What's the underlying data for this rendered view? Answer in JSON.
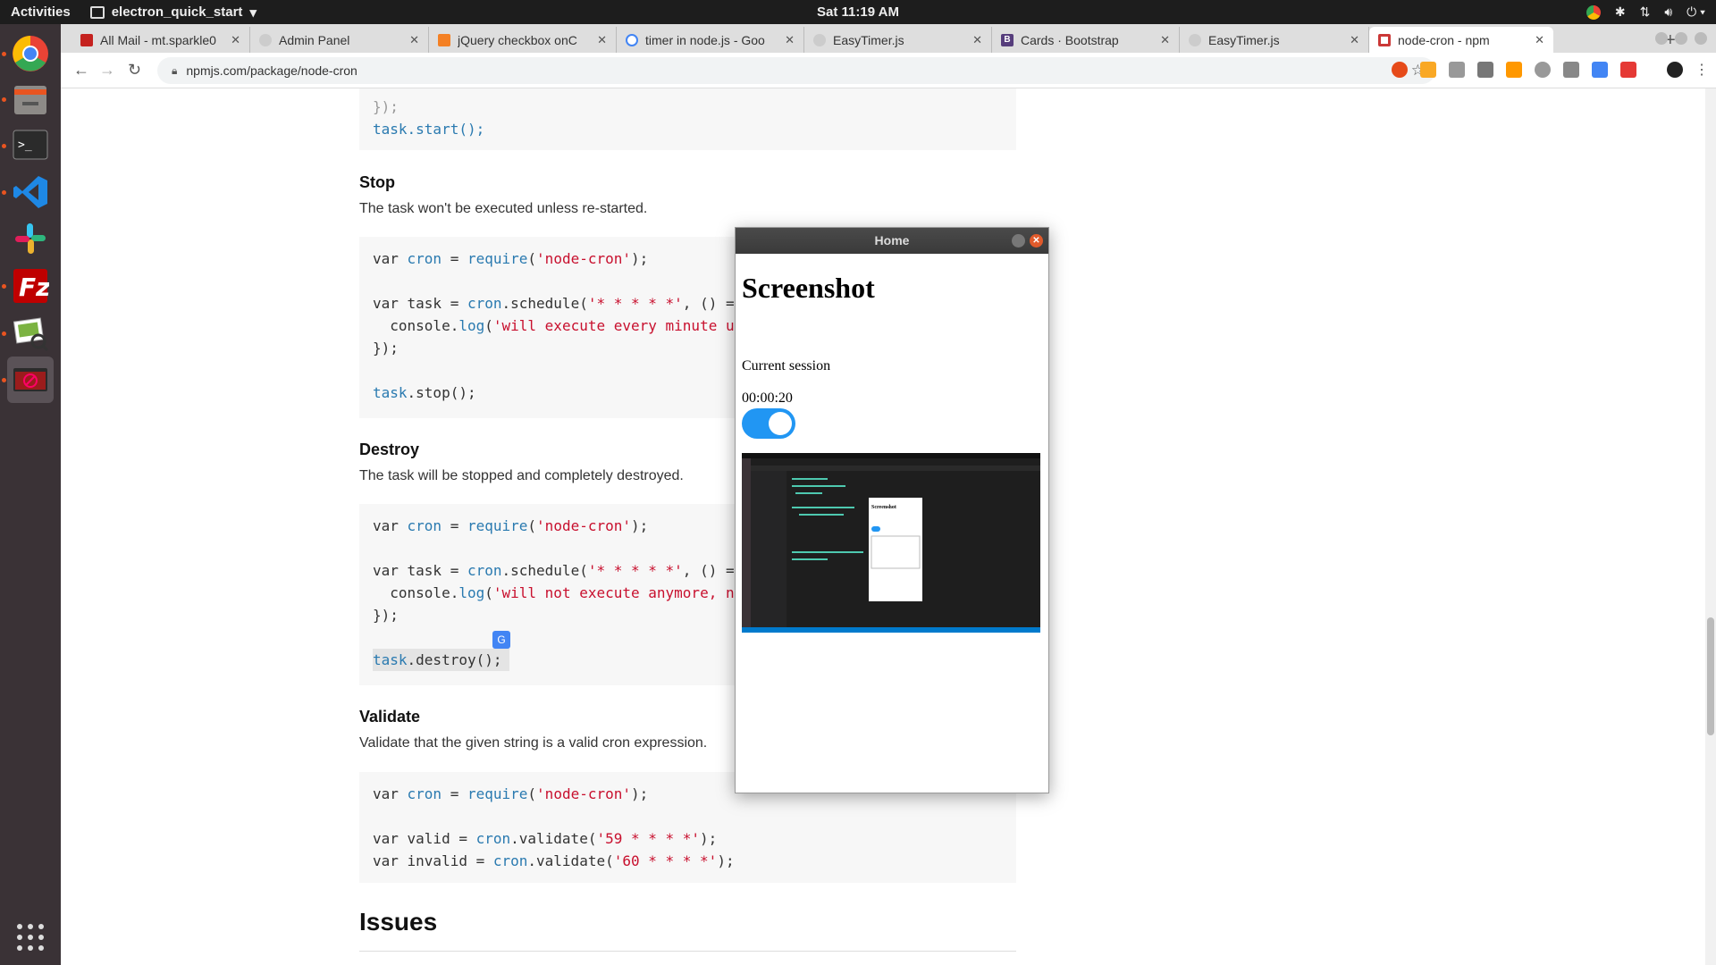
{
  "topbar": {
    "activities": "Activities",
    "app_name": "electron_quick_start",
    "clock": "Sat 11:19 AM"
  },
  "dock": {
    "items": [
      "chrome-icon",
      "files-icon",
      "terminal-icon",
      "vscode-icon",
      "slack-icon",
      "filezilla-icon",
      "image-viewer-icon",
      "electron-icon",
      "app-grid-icon"
    ]
  },
  "tabs": [
    {
      "title": "All Mail - mt.sparkle0",
      "color": "#c5221f"
    },
    {
      "title": "Admin Panel",
      "color": "#aaaaaa"
    },
    {
      "title": "jQuery checkbox onC",
      "color": "#f48024"
    },
    {
      "title": "timer in node.js - Goo",
      "color": "#4285f4"
    },
    {
      "title": "EasyTimer.js",
      "color": "#aaaaaa"
    },
    {
      "title": "Cards · Bootstrap",
      "color": "#563d7c"
    },
    {
      "title": "EasyTimer.js",
      "color": "#aaaaaa"
    },
    {
      "title": "node-cron - npm",
      "color": "#cb3837"
    }
  ],
  "address": {
    "url": "npmjs.com/package/node-cron"
  },
  "doc": {
    "code_top_last": "task.start();",
    "stop_heading": "Stop",
    "stop_text": "The task won't be executed unless re-started.",
    "stop_code": [
      "var cron = require('node-cron');",
      "",
      "var task = cron.schedule('* * * * *', () =>",
      "  console.log('will execute every minute u",
      "});",
      "",
      "task.stop();"
    ],
    "destroy_heading": "Destroy",
    "destroy_text": "The task will be stopped and completely destroyed.",
    "destroy_code": [
      "var cron = require('node-cron');",
      "",
      "var task = cron.schedule('* * * * *', () =>",
      "  console.log('will not execute anymore, n",
      "});",
      "",
      "task.destroy();"
    ],
    "validate_heading": "Validate",
    "validate_text": "Validate that the given string is a valid cron expression.",
    "validate_code": [
      "var cron = require('node-cron');",
      "",
      "var valid = cron.validate('59 * * * *');",
      "var invalid = cron.validate('60 * * * *');"
    ],
    "issues_heading": "Issues"
  },
  "window": {
    "title": "Home",
    "heading": "Screenshot",
    "label": "Current session",
    "timer": "00:00:20",
    "toggle_on": true
  }
}
